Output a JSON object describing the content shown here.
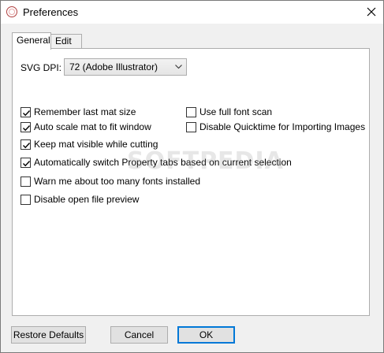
{
  "window": {
    "title": "Preferences"
  },
  "tabs": [
    {
      "label": "General",
      "active": true
    },
    {
      "label": "Edit",
      "active": false
    }
  ],
  "svg_dpi": {
    "label": "SVG DPI:",
    "selected": "72 (Adobe Illustrator)"
  },
  "options_left": [
    {
      "label": "Remember last mat size",
      "checked": true
    },
    {
      "label": "Auto scale mat to fit window",
      "checked": true
    },
    {
      "label": "Keep mat visible while cutting",
      "checked": true
    },
    {
      "label": "Automatically switch Property tabs based on current selection",
      "checked": true
    },
    {
      "label": "Warn me about too many fonts installed",
      "checked": false
    },
    {
      "label": "Disable open file preview",
      "checked": false
    }
  ],
  "options_right": [
    {
      "label": "Use full font scan",
      "checked": false
    },
    {
      "label": "Disable Quicktime for Importing Images",
      "checked": false
    }
  ],
  "buttons": {
    "restore_defaults": "Restore Defaults",
    "cancel": "Cancel",
    "ok": "OK"
  },
  "watermark": "SOFTPEDIA",
  "icons": {
    "app": "app-logo-icon",
    "close": "close-icon",
    "dropdown": "chevron-down-icon",
    "check": "check-icon"
  }
}
